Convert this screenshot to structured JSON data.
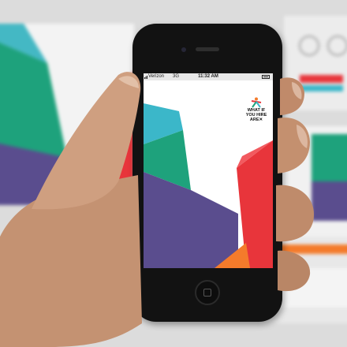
{
  "phone_screen": {
    "status_bar": {
      "carrier": "Verizon",
      "network": "3G",
      "time": "11:32 AM"
    },
    "logo": {
      "lines": [
        "WHAT IF",
        "YOU HIRE",
        "ARE✕"
      ]
    }
  },
  "colors": {
    "teal": "#3bb7c9",
    "green": "#1ea27c",
    "purple": "#5a4d8e",
    "red": "#e8353b",
    "orange": "#f47b2b",
    "skin": "#c49272"
  }
}
